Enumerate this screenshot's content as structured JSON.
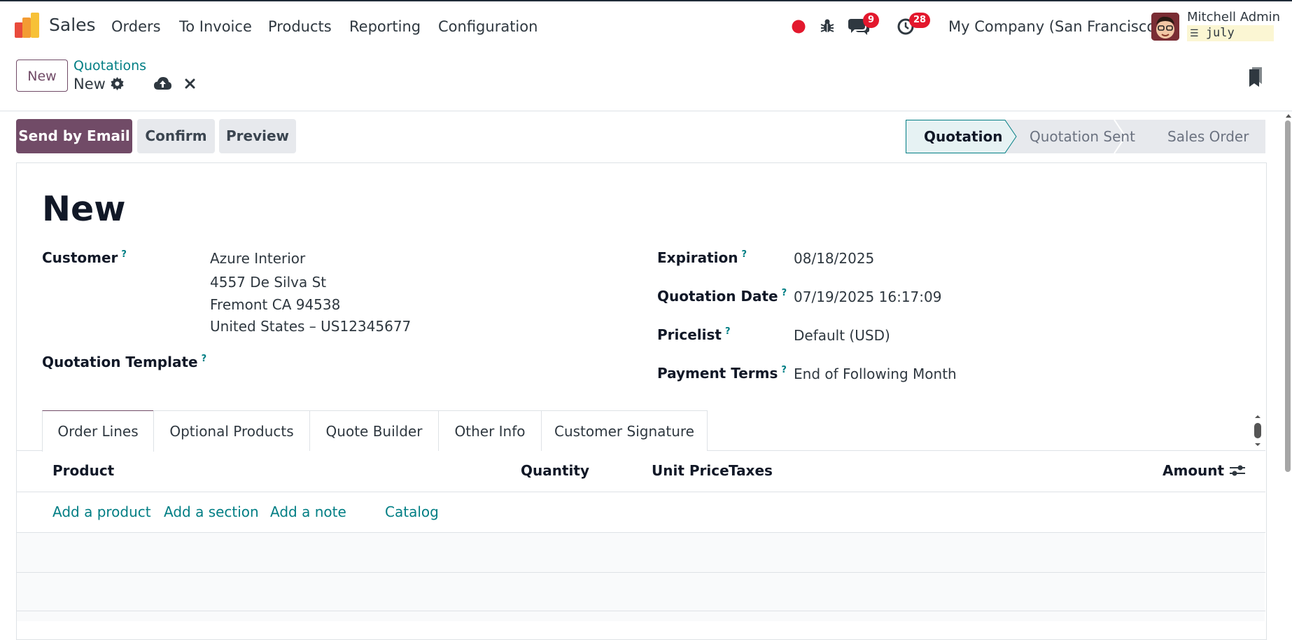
{
  "navbar": {
    "app_name": "Sales",
    "menu": [
      "Orders",
      "To Invoice",
      "Products",
      "Reporting",
      "Configuration"
    ],
    "messages_count": "9",
    "activities_count": "28",
    "company": "My Company (San Francisco)",
    "user_name": "Mitchell Admin",
    "database": "july",
    "icons": [
      "record-dot-icon",
      "bug-icon",
      "chat-icon",
      "clock-icon"
    ]
  },
  "control": {
    "new_label": "New",
    "breadcrumb_parent": "Quotations",
    "breadcrumb_current": "New"
  },
  "actions": {
    "send_email": "Send by Email",
    "confirm": "Confirm",
    "preview": "Preview"
  },
  "status": [
    "Quotation",
    "Quotation Sent",
    "Sales Order"
  ],
  "form": {
    "title": "New",
    "customer_label": "Customer",
    "customer_lines": [
      "Azure Interior",
      "4557 De Silva St",
      "Fremont CA 94538",
      "United States – US12345677"
    ],
    "template_label": "Quotation Template",
    "expiration_label": "Expiration",
    "expiration_value": "08/18/2025",
    "quotation_date_label": "Quotation Date",
    "quotation_date_value": "07/19/2025 16:17:09",
    "pricelist_label": "Pricelist",
    "pricelist_value": "Default (USD)",
    "payment_terms_label": "Payment Terms",
    "payment_terms_value": "End of Following Month",
    "help_mark": "?"
  },
  "tabs": [
    "Order Lines",
    "Optional Products",
    "Quote Builder",
    "Other Info",
    "Customer Signature"
  ],
  "table": {
    "headers": [
      "Product",
      "Quantity",
      "Unit Price",
      "Taxes",
      "Amount"
    ],
    "add_links": [
      "Add a product",
      "Add a section",
      "Add a note",
      "Catalog"
    ]
  },
  "colors": {
    "brand": "#714b67",
    "link": "#017e84",
    "badge": "#e3182d"
  }
}
